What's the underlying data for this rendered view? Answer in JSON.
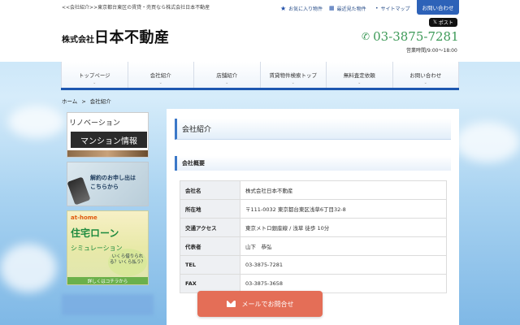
{
  "top": {
    "tagline": "<<会社紹介>>東京都台東区の賃貸・売買なら株式会社日本不動産",
    "favorites": "お気に入り物件",
    "recent": "最近見た物件",
    "sitemap": "サイトマップ",
    "contact": "お問い合わせ"
  },
  "header": {
    "logo_small": "株式会社",
    "logo_big": "日本不動産",
    "x_post": "ポスト",
    "phone": "03-3875-7281",
    "hours": "営業時間/9:00～18:00"
  },
  "nav": [
    {
      "label": "トップページ"
    },
    {
      "label": "会社紹介"
    },
    {
      "label": "店舗紹介"
    },
    {
      "label": "賃貸物件検索トップ"
    },
    {
      "label": "無料査定依頼"
    },
    {
      "label": "お問い合わせ"
    }
  ],
  "breadcrumb": {
    "home": "ホーム",
    "sep": ">",
    "current": "会社紹介"
  },
  "sidebar": {
    "reno_line1": "リノベーション",
    "reno_line2": "マンション情報",
    "cancel_line1": "解約のお申し出は",
    "cancel_line2": "こちらから",
    "loan_brand": "at-home",
    "loan_title": "住宅ローン",
    "loan_sub": "シミュレーション",
    "loan_q": "いくら借りられる？いくら払う？",
    "loan_foot": "詳しくはコチラから"
  },
  "main": {
    "title": "会社紹介",
    "section": "会社概要",
    "rows": [
      {
        "k": "会社名",
        "v": "株式会社日本不動産"
      },
      {
        "k": "所在地",
        "v": "〒111-0032 東京都台東区浅草6丁目32-8"
      },
      {
        "k": "交通アクセス",
        "v": "東京メトロ銀座線 / 浅草 徒歩 10分"
      },
      {
        "k": "代表者",
        "v": "山下　恭弘"
      },
      {
        "k": "TEL",
        "v": "03-3875-7281"
      },
      {
        "k": "FAX",
        "v": "03-3875-3658"
      }
    ]
  },
  "mail_button": "メールでお問合せ",
  "colors": {
    "accent": "#2d62b8",
    "nav_underline": "#1c56b0",
    "phone": "#3d9a58",
    "mail": "#e46e57"
  }
}
